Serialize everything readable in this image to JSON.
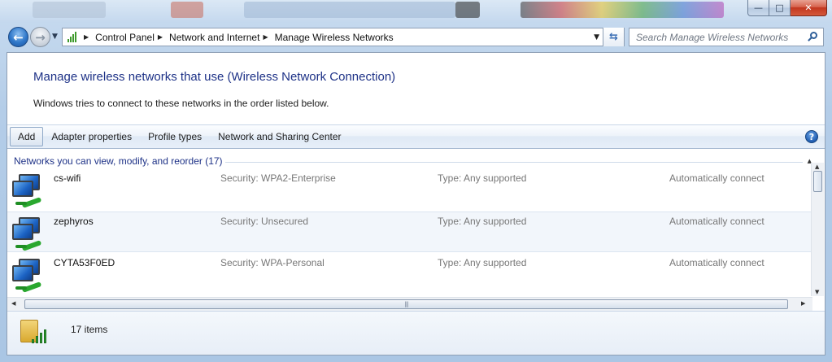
{
  "window": {
    "caption_buttons": {
      "minimize": "—",
      "maximize": "□",
      "close": "✕"
    }
  },
  "navigation": {
    "back_glyph": "←",
    "forward_glyph": "→",
    "breadcrumbs": [
      "Control Panel",
      "Network and Internet",
      "Manage Wireless Networks"
    ],
    "search_placeholder": "Search Manage Wireless Networks"
  },
  "header": {
    "title": "Manage wireless networks that use (Wireless Network Connection)",
    "description": "Windows tries to connect to these networks in the order listed below."
  },
  "toolbar": {
    "items": [
      "Add",
      "Adapter properties",
      "Profile types",
      "Network and Sharing Center"
    ],
    "help_glyph": "?"
  },
  "networks": {
    "group_label": "Networks you can view, modify, and reorder (17)",
    "rows": [
      {
        "name": "cs-wifi",
        "security": "Security:  WPA2-Enterprise",
        "type": "Type:  Any supported",
        "connect": "Automatically connect"
      },
      {
        "name": "zephyros",
        "security": "Security:  Unsecured",
        "type": "Type:  Any supported",
        "connect": "Automatically connect"
      },
      {
        "name": "CYTA53F0ED",
        "security": "Security:  WPA-Personal",
        "type": "Type:  Any supported",
        "connect": "Automatically connect"
      }
    ]
  },
  "status": {
    "item_count": "17 items"
  },
  "colors": {
    "heading": "#1e3287",
    "selected_row": "#f2f6fb",
    "signal_green": "#2da02f"
  },
  "icons": {
    "network": "wireless-network-icon",
    "address": "signal-bars-icon",
    "details": "folder-signal-icon"
  }
}
